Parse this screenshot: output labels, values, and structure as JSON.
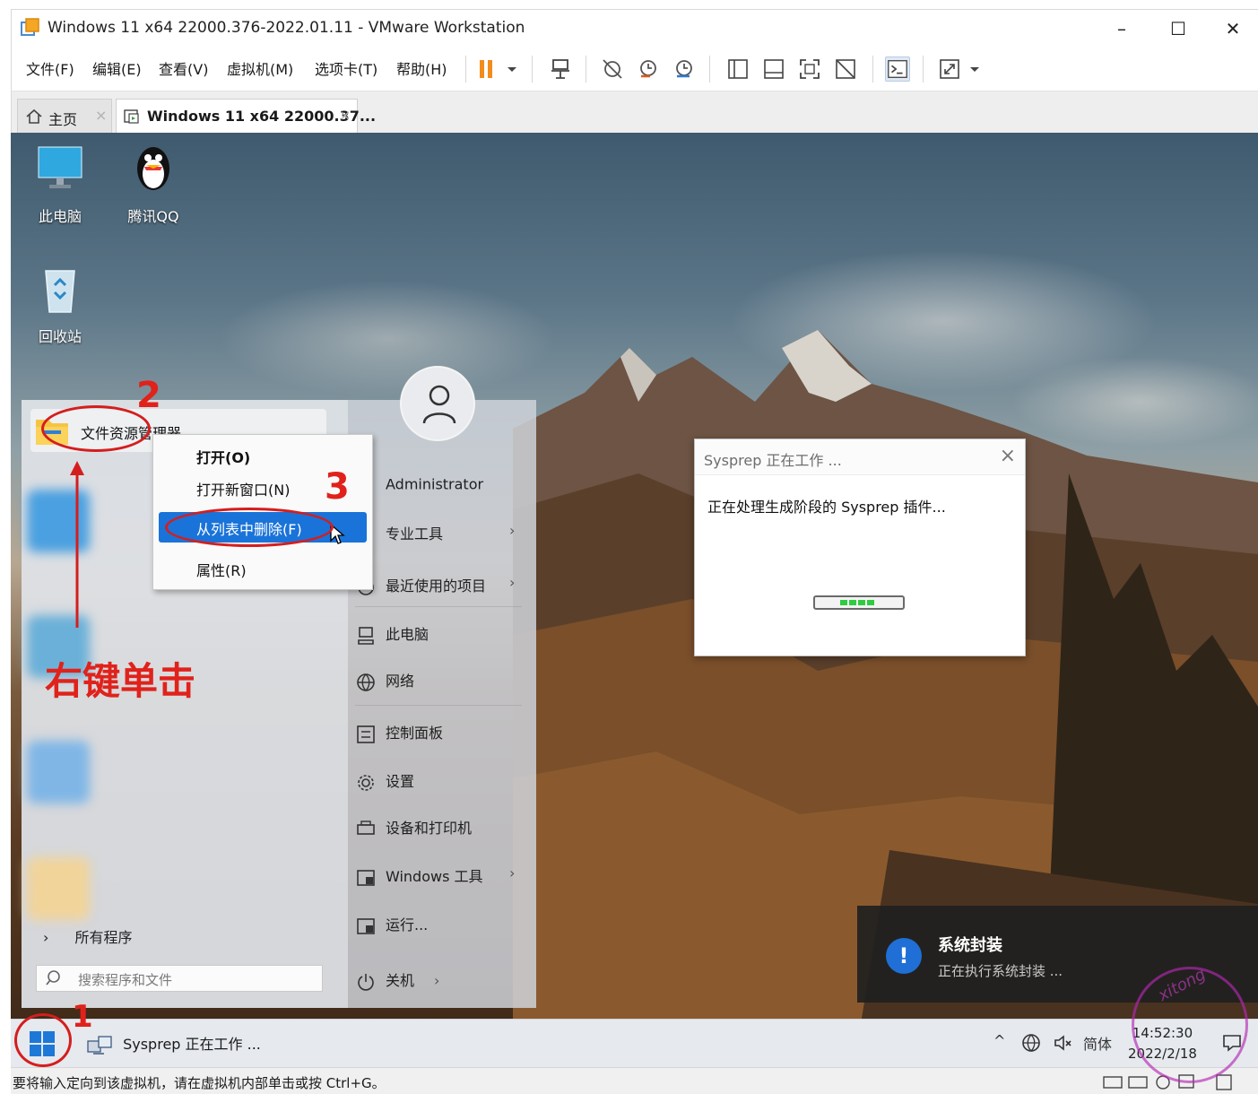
{
  "vm_window": {
    "title": "Windows 11 x64 22000.376-2022.01.11 - VMware Workstation",
    "controls": [
      "–",
      "☐",
      "✕"
    ]
  },
  "menubar": {
    "items": [
      "文件(F)",
      "编辑(E)",
      "查看(V)",
      "虚拟机(M)",
      "选项卡(T)",
      "帮助(H)"
    ]
  },
  "tabs": {
    "home_label": "主页",
    "vm_label": "Windows 11 x64 22000.37...",
    "close_glyph": "×"
  },
  "desktop_icons": [
    {
      "label": "此电脑",
      "icon": "monitor-icon"
    },
    {
      "label": "腾讯QQ",
      "icon": "qq-penguin-icon"
    },
    {
      "label": "回收站",
      "icon": "recycle-bin-icon"
    }
  ],
  "start_menu": {
    "pinned_item": "文件资源管理器",
    "all_programs": "所有程序",
    "search_placeholder": "搜索程序和文件",
    "right_items": [
      {
        "label": "Administrator"
      },
      {
        "label": "专业工具",
        "submenu": true
      },
      {
        "label": "最近使用的项目",
        "submenu": true
      },
      {
        "label": "此电脑"
      },
      {
        "label": "网络"
      },
      {
        "label": "控制面板"
      },
      {
        "label": "设置"
      },
      {
        "label": "设备和打印机"
      },
      {
        "label": "Windows 工具",
        "submenu": true
      },
      {
        "label": "运行..."
      }
    ],
    "shutdown": "关机"
  },
  "context_menu": {
    "items": [
      "打开(O)",
      "打开新窗口(N)",
      "从列表中删除(F)",
      "属性(R)"
    ],
    "highlighted_index": 2
  },
  "sysprep_dialog": {
    "title": "Sysprep 正在工作 ...",
    "message": "正在处理生成阶段的 Sysprep 插件..."
  },
  "toast": {
    "title": "系统封装",
    "subtitle": "正在执行系统封装 ..."
  },
  "taskbar": {
    "task_label": "Sysprep 正在工作 ...",
    "ime": "简体",
    "time": "14:52:30",
    "date": "2022/2/18"
  },
  "status_bar": {
    "text": "要将输入定向到该虚拟机，请在虚拟机内部单击或按 Ctrl+G。"
  },
  "annotations": {
    "step1": "1",
    "step2": "2",
    "step3": "3",
    "instruction": "右键单击",
    "color": "#e0221b"
  },
  "watermark": "xitong"
}
